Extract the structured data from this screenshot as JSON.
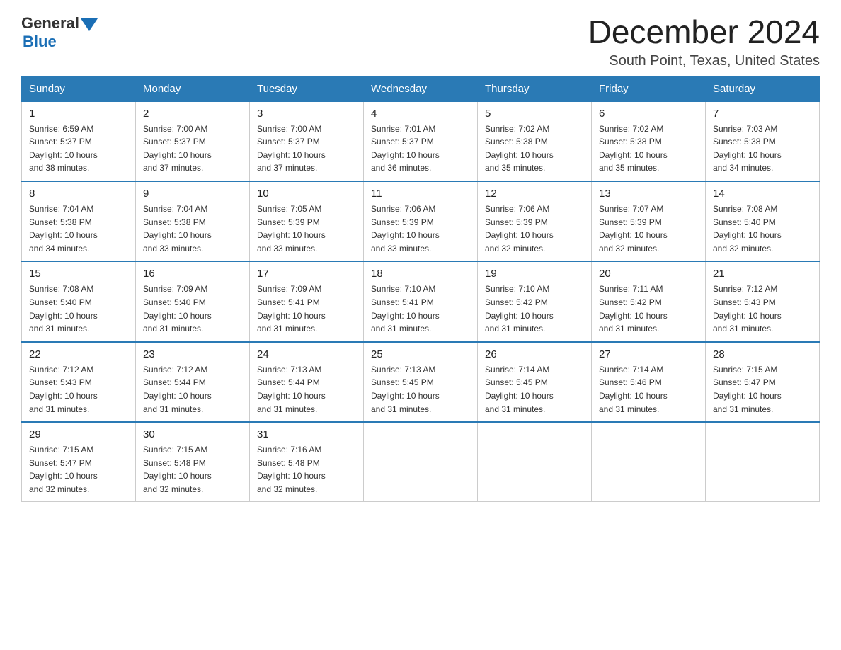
{
  "logo": {
    "general": "General",
    "blue": "Blue"
  },
  "title": {
    "month_year": "December 2024",
    "location": "South Point, Texas, United States"
  },
  "days_of_week": [
    "Sunday",
    "Monday",
    "Tuesday",
    "Wednesday",
    "Thursday",
    "Friday",
    "Saturday"
  ],
  "weeks": [
    [
      {
        "day": "1",
        "sunrise": "6:59 AM",
        "sunset": "5:37 PM",
        "daylight": "10 hours and 38 minutes."
      },
      {
        "day": "2",
        "sunrise": "7:00 AM",
        "sunset": "5:37 PM",
        "daylight": "10 hours and 37 minutes."
      },
      {
        "day": "3",
        "sunrise": "7:00 AM",
        "sunset": "5:37 PM",
        "daylight": "10 hours and 37 minutes."
      },
      {
        "day": "4",
        "sunrise": "7:01 AM",
        "sunset": "5:37 PM",
        "daylight": "10 hours and 36 minutes."
      },
      {
        "day": "5",
        "sunrise": "7:02 AM",
        "sunset": "5:38 PM",
        "daylight": "10 hours and 35 minutes."
      },
      {
        "day": "6",
        "sunrise": "7:02 AM",
        "sunset": "5:38 PM",
        "daylight": "10 hours and 35 minutes."
      },
      {
        "day": "7",
        "sunrise": "7:03 AM",
        "sunset": "5:38 PM",
        "daylight": "10 hours and 34 minutes."
      }
    ],
    [
      {
        "day": "8",
        "sunrise": "7:04 AM",
        "sunset": "5:38 PM",
        "daylight": "10 hours and 34 minutes."
      },
      {
        "day": "9",
        "sunrise": "7:04 AM",
        "sunset": "5:38 PM",
        "daylight": "10 hours and 33 minutes."
      },
      {
        "day": "10",
        "sunrise": "7:05 AM",
        "sunset": "5:39 PM",
        "daylight": "10 hours and 33 minutes."
      },
      {
        "day": "11",
        "sunrise": "7:06 AM",
        "sunset": "5:39 PM",
        "daylight": "10 hours and 33 minutes."
      },
      {
        "day": "12",
        "sunrise": "7:06 AM",
        "sunset": "5:39 PM",
        "daylight": "10 hours and 32 minutes."
      },
      {
        "day": "13",
        "sunrise": "7:07 AM",
        "sunset": "5:39 PM",
        "daylight": "10 hours and 32 minutes."
      },
      {
        "day": "14",
        "sunrise": "7:08 AM",
        "sunset": "5:40 PM",
        "daylight": "10 hours and 32 minutes."
      }
    ],
    [
      {
        "day": "15",
        "sunrise": "7:08 AM",
        "sunset": "5:40 PM",
        "daylight": "10 hours and 31 minutes."
      },
      {
        "day": "16",
        "sunrise": "7:09 AM",
        "sunset": "5:40 PM",
        "daylight": "10 hours and 31 minutes."
      },
      {
        "day": "17",
        "sunrise": "7:09 AM",
        "sunset": "5:41 PM",
        "daylight": "10 hours and 31 minutes."
      },
      {
        "day": "18",
        "sunrise": "7:10 AM",
        "sunset": "5:41 PM",
        "daylight": "10 hours and 31 minutes."
      },
      {
        "day": "19",
        "sunrise": "7:10 AM",
        "sunset": "5:42 PM",
        "daylight": "10 hours and 31 minutes."
      },
      {
        "day": "20",
        "sunrise": "7:11 AM",
        "sunset": "5:42 PM",
        "daylight": "10 hours and 31 minutes."
      },
      {
        "day": "21",
        "sunrise": "7:12 AM",
        "sunset": "5:43 PM",
        "daylight": "10 hours and 31 minutes."
      }
    ],
    [
      {
        "day": "22",
        "sunrise": "7:12 AM",
        "sunset": "5:43 PM",
        "daylight": "10 hours and 31 minutes."
      },
      {
        "day": "23",
        "sunrise": "7:12 AM",
        "sunset": "5:44 PM",
        "daylight": "10 hours and 31 minutes."
      },
      {
        "day": "24",
        "sunrise": "7:13 AM",
        "sunset": "5:44 PM",
        "daylight": "10 hours and 31 minutes."
      },
      {
        "day": "25",
        "sunrise": "7:13 AM",
        "sunset": "5:45 PM",
        "daylight": "10 hours and 31 minutes."
      },
      {
        "day": "26",
        "sunrise": "7:14 AM",
        "sunset": "5:45 PM",
        "daylight": "10 hours and 31 minutes."
      },
      {
        "day": "27",
        "sunrise": "7:14 AM",
        "sunset": "5:46 PM",
        "daylight": "10 hours and 31 minutes."
      },
      {
        "day": "28",
        "sunrise": "7:15 AM",
        "sunset": "5:47 PM",
        "daylight": "10 hours and 31 minutes."
      }
    ],
    [
      {
        "day": "29",
        "sunrise": "7:15 AM",
        "sunset": "5:47 PM",
        "daylight": "10 hours and 32 minutes."
      },
      {
        "day": "30",
        "sunrise": "7:15 AM",
        "sunset": "5:48 PM",
        "daylight": "10 hours and 32 minutes."
      },
      {
        "day": "31",
        "sunrise": "7:16 AM",
        "sunset": "5:48 PM",
        "daylight": "10 hours and 32 minutes."
      },
      null,
      null,
      null,
      null
    ]
  ],
  "labels": {
    "sunrise": "Sunrise:",
    "sunset": "Sunset:",
    "daylight": "Daylight:"
  }
}
